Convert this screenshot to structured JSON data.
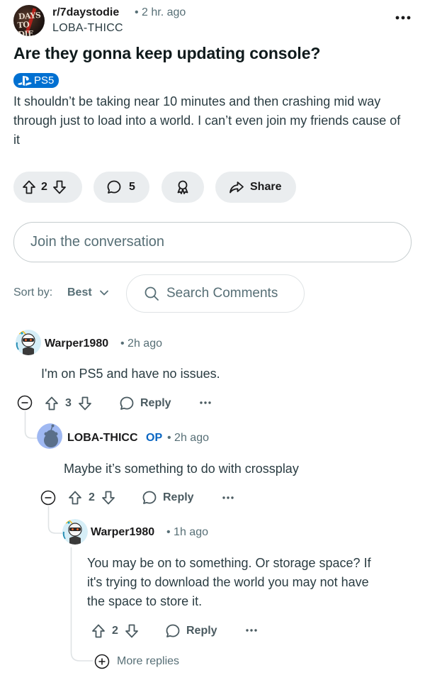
{
  "post": {
    "subreddit": "r/7daystodie",
    "time": "• 2 hr. ago",
    "author": "LOBA-THICC",
    "title": "Are they gonna keep updating console?",
    "flair": "PS5",
    "body": "It shouldn’t be taking near 10 minutes and then crashing mid way through just to load into a world. I can’t even join my friends cause of it",
    "upvotes": "2",
    "comments": "5",
    "share_label": "Share",
    "more_icon": "ellipsis-icon",
    "subreddit_avatar_text": [
      "DAYS",
      "TO DIE"
    ]
  },
  "composer": {
    "placeholder": "Join the conversation"
  },
  "sort": {
    "label": "Sort by:",
    "value": "Best",
    "search_placeholder": "Search Comments"
  },
  "comments": [
    {
      "author": "Warper1980",
      "time": "2h ago",
      "text": "I'm on PS5 and have no issues.",
      "score": "3",
      "reply_label": "Reply"
    },
    {
      "author": "LOBA-THICC",
      "op_label": "OP",
      "time": "2h ago",
      "text": "Maybe it’s something to do with crossplay",
      "score": "2",
      "reply_label": "Reply"
    },
    {
      "author": "Warper1980",
      "time": "1h ago",
      "text_lines": [
        "You may be on to something. Or storage space? If",
        "it's trying to download the world you may not have",
        "the space to store it."
      ],
      "score": "2",
      "reply_label": "Reply"
    }
  ],
  "more_replies_label": "More replies",
  "colors": {
    "flair_bg": "#0070d1",
    "op_blue": "#0a66c2",
    "pill_bg": "#eaedef",
    "meta_gray": "#576f76"
  }
}
